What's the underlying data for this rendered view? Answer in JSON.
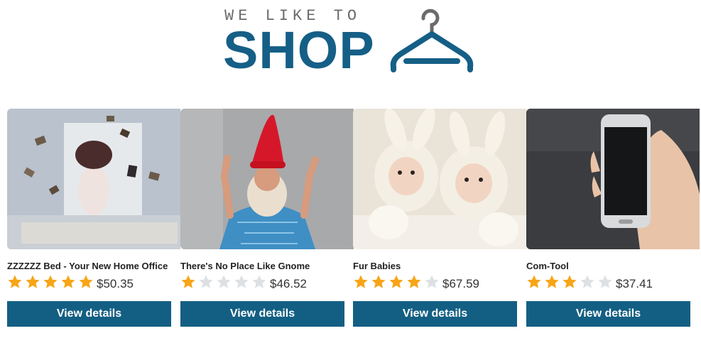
{
  "header": {
    "tagline": "WE LIKE TO",
    "word": "SHOP"
  },
  "colors": {
    "brand": "#155f86",
    "button": "#135f83",
    "star_filled": "#f7a517",
    "star_empty": "#dde1e4"
  },
  "products": [
    {
      "title": "ZZZZZZ Bed - Your New Home Office",
      "rating": 5,
      "max_rating": 5,
      "price": "$50.35",
      "button_label": "View details",
      "image": "woman-with-flying-books"
    },
    {
      "title": "There's No Place Like Gnome",
      "rating": 1,
      "max_rating": 5,
      "price": "$46.52",
      "button_label": "View details",
      "image": "man-in-gnome-hat"
    },
    {
      "title": "Fur Babies",
      "rating": 4,
      "max_rating": 5,
      "price": "$67.59",
      "button_label": "View details",
      "image": "babies-in-bunny-costumes"
    },
    {
      "title": "Com-Tool",
      "rating": 3,
      "max_rating": 5,
      "price": "$37.41",
      "button_label": "View details",
      "image": "hand-holding-smartphone"
    }
  ]
}
